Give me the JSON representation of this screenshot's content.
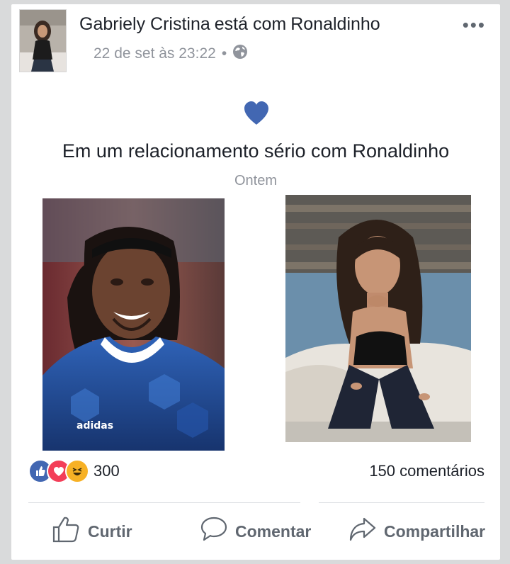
{
  "post": {
    "author": "Gabriely Cristina",
    "connector": "está com",
    "tagged": "Ronaldinho",
    "timestamp": "22 de set às 23:22",
    "separator": "•",
    "privacy_icon": "globe-icon",
    "more_icon": "•••"
  },
  "life_event": {
    "icon": "heart-icon",
    "title": "Em um relacionamento sério com Ronaldinho",
    "date": "Ontem"
  },
  "footer": {
    "reaction_icons": [
      "like-icon",
      "love-icon",
      "haha-icon"
    ],
    "reaction_count": "300",
    "comments_count": "150",
    "comments_label": "comentários"
  },
  "actions": {
    "like": "Curtir",
    "comment": "Comentar",
    "share": "Compartilhar"
  },
  "colors": {
    "facebook_blue": "#4267b2",
    "love_red": "#f33e58",
    "haha_yellow": "#f7b125",
    "meta_gray": "#90949c",
    "action_gray": "#606770"
  }
}
